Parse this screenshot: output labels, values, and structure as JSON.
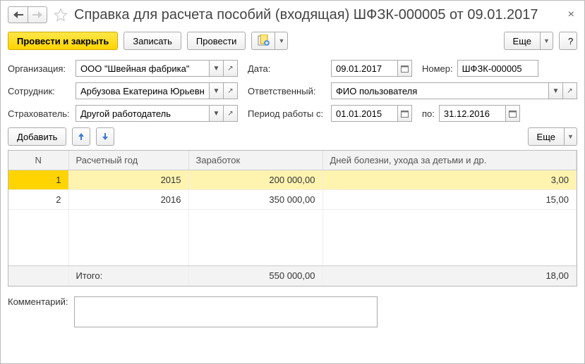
{
  "title": "Справка для расчета пособий (входящая) ШФЗК-000005 от 09.01.2017",
  "toolbar": {
    "post_close": "Провести и закрыть",
    "save": "Записать",
    "post": "Провести",
    "more": "Еще",
    "help": "?"
  },
  "labels": {
    "org": "Организация:",
    "date": "Дата:",
    "number": "Номер:",
    "employee": "Сотрудник:",
    "responsible": "Ответственный:",
    "insurer": "Страхователь:",
    "period_from": "Период работы с:",
    "period_to": "по:",
    "add": "Добавить",
    "more2": "Еще",
    "comment": "Комментарий:"
  },
  "fields": {
    "org": "ООО \"Швейная фабрика\"",
    "date": "09.01.2017",
    "number": "ШФЗК-000005",
    "employee": "Арбузова Екатерина Юрьевна",
    "responsible": "ФИО пользователя",
    "insurer": "Другой работодатель",
    "period_from": "01.01.2015",
    "period_to": "31.12.2016"
  },
  "table": {
    "headers": {
      "n": "N",
      "year": "Расчетный год",
      "earn": "Заработок",
      "days": "Дней болезни, ухода за детьми и др."
    },
    "rows": [
      {
        "n": "1",
        "year": "2015",
        "earn": "200 000,00",
        "days": "3,00"
      },
      {
        "n": "2",
        "year": "2016",
        "earn": "350 000,00",
        "days": "15,00"
      }
    ],
    "total": {
      "label": "Итого:",
      "earn": "550 000,00",
      "days": "18,00"
    }
  }
}
